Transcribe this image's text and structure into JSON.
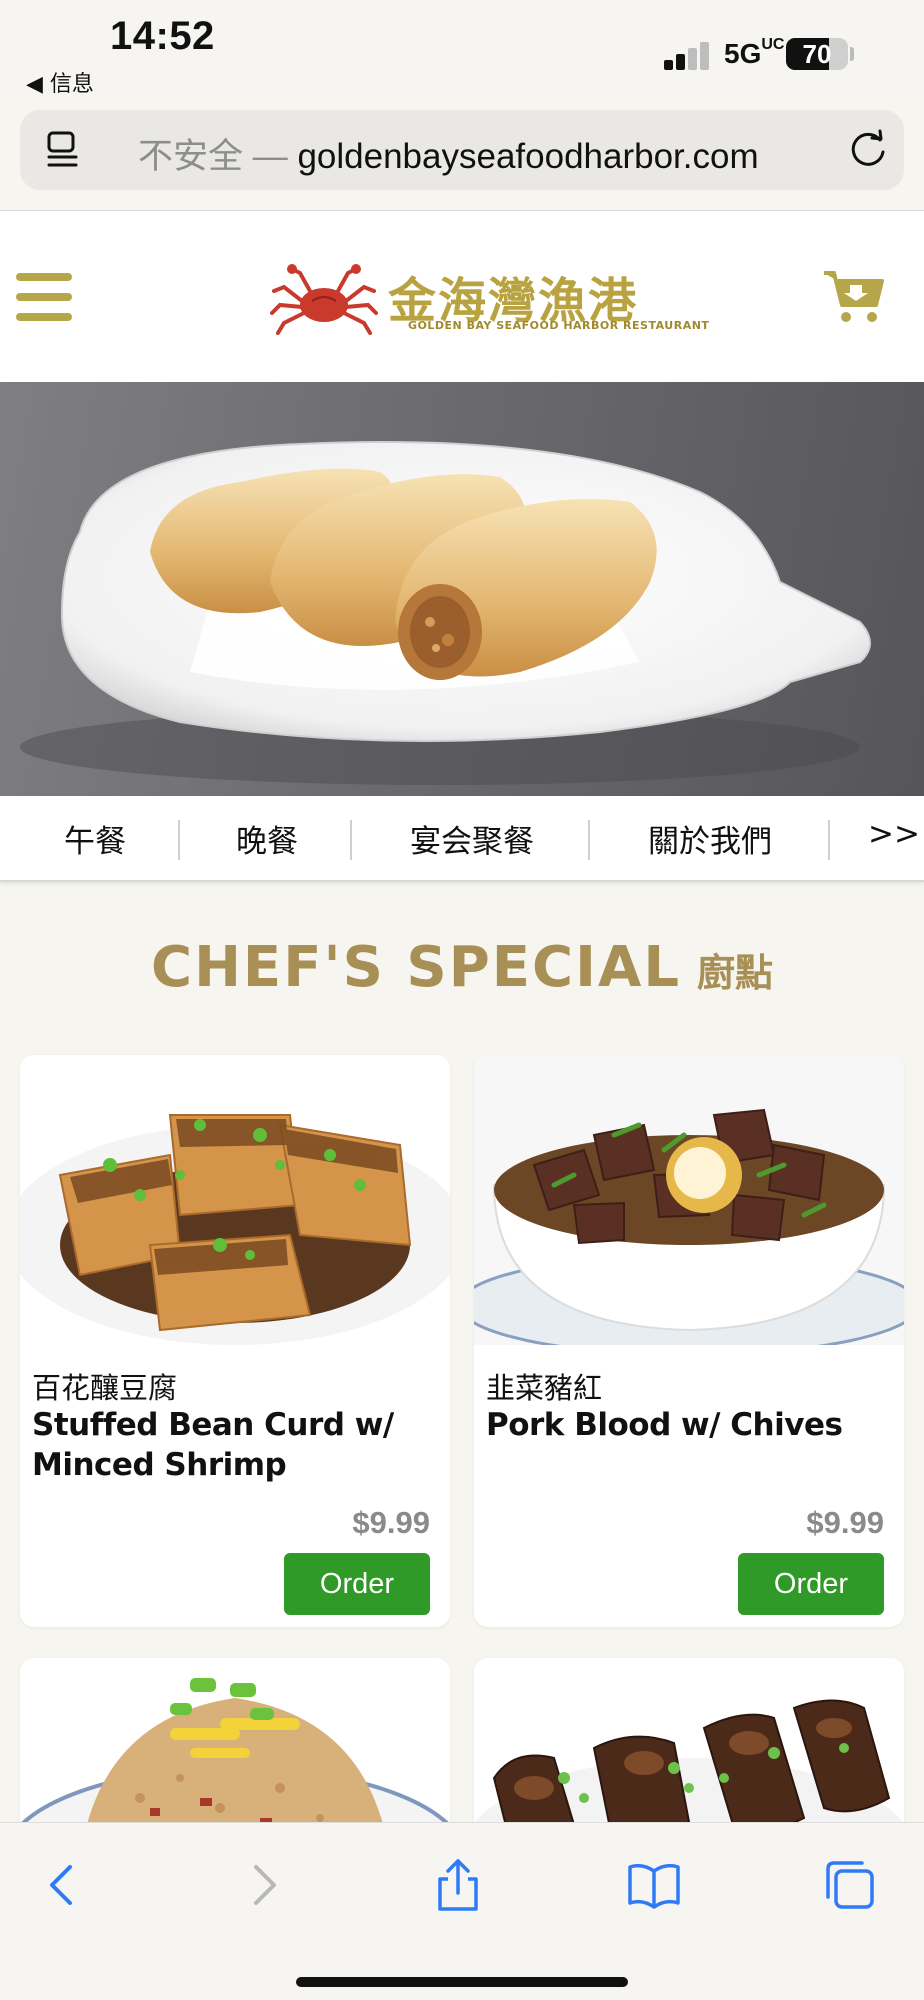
{
  "status_bar": {
    "time": "14:52",
    "back_app": "◀ 信息",
    "network": "5G",
    "network_sub": "UC",
    "battery_level": "70",
    "battery_fraction": 0.7
  },
  "browser": {
    "security_label": "不安全 — ",
    "url": "goldenbayseafoodharbor.com",
    "reader_icon": "reader-mode-icon",
    "reload_icon": "reload-icon"
  },
  "site_header": {
    "menu_icon": "hamburger-menu-icon",
    "logo_cn": "金海灣漁港",
    "logo_en": "GOLDEN BAY SEAFOOD HARBOR RESTAURANT",
    "cart_icon": "shopping-cart-icon",
    "accent_color": "#b5a64a"
  },
  "hero": {
    "image": "fried spring rolls on white plate"
  },
  "nav": {
    "items": [
      "午餐",
      "晚餐",
      "宴会聚餐",
      "關於我們"
    ],
    "more": ">>"
  },
  "section": {
    "title_en": "CHEF'S SPECIAL",
    "title_cn": "廚點",
    "title_color": "#a88f56"
  },
  "menu_items": [
    {
      "name_cn": "百花釀豆腐",
      "name_en": "Stuffed Bean Curd w/ Minced Shrimp",
      "price": "$9.99",
      "order_label": "Order"
    },
    {
      "name_cn": "韭菜豬紅",
      "name_en": "Pork Blood w/ Chives",
      "price": "$9.99",
      "order_label": "Order"
    }
  ],
  "order_button_color": "#2f9a27",
  "toolbar": {
    "icons": [
      "back-icon",
      "forward-icon",
      "share-icon",
      "bookmarks-icon",
      "tabs-icon"
    ]
  }
}
